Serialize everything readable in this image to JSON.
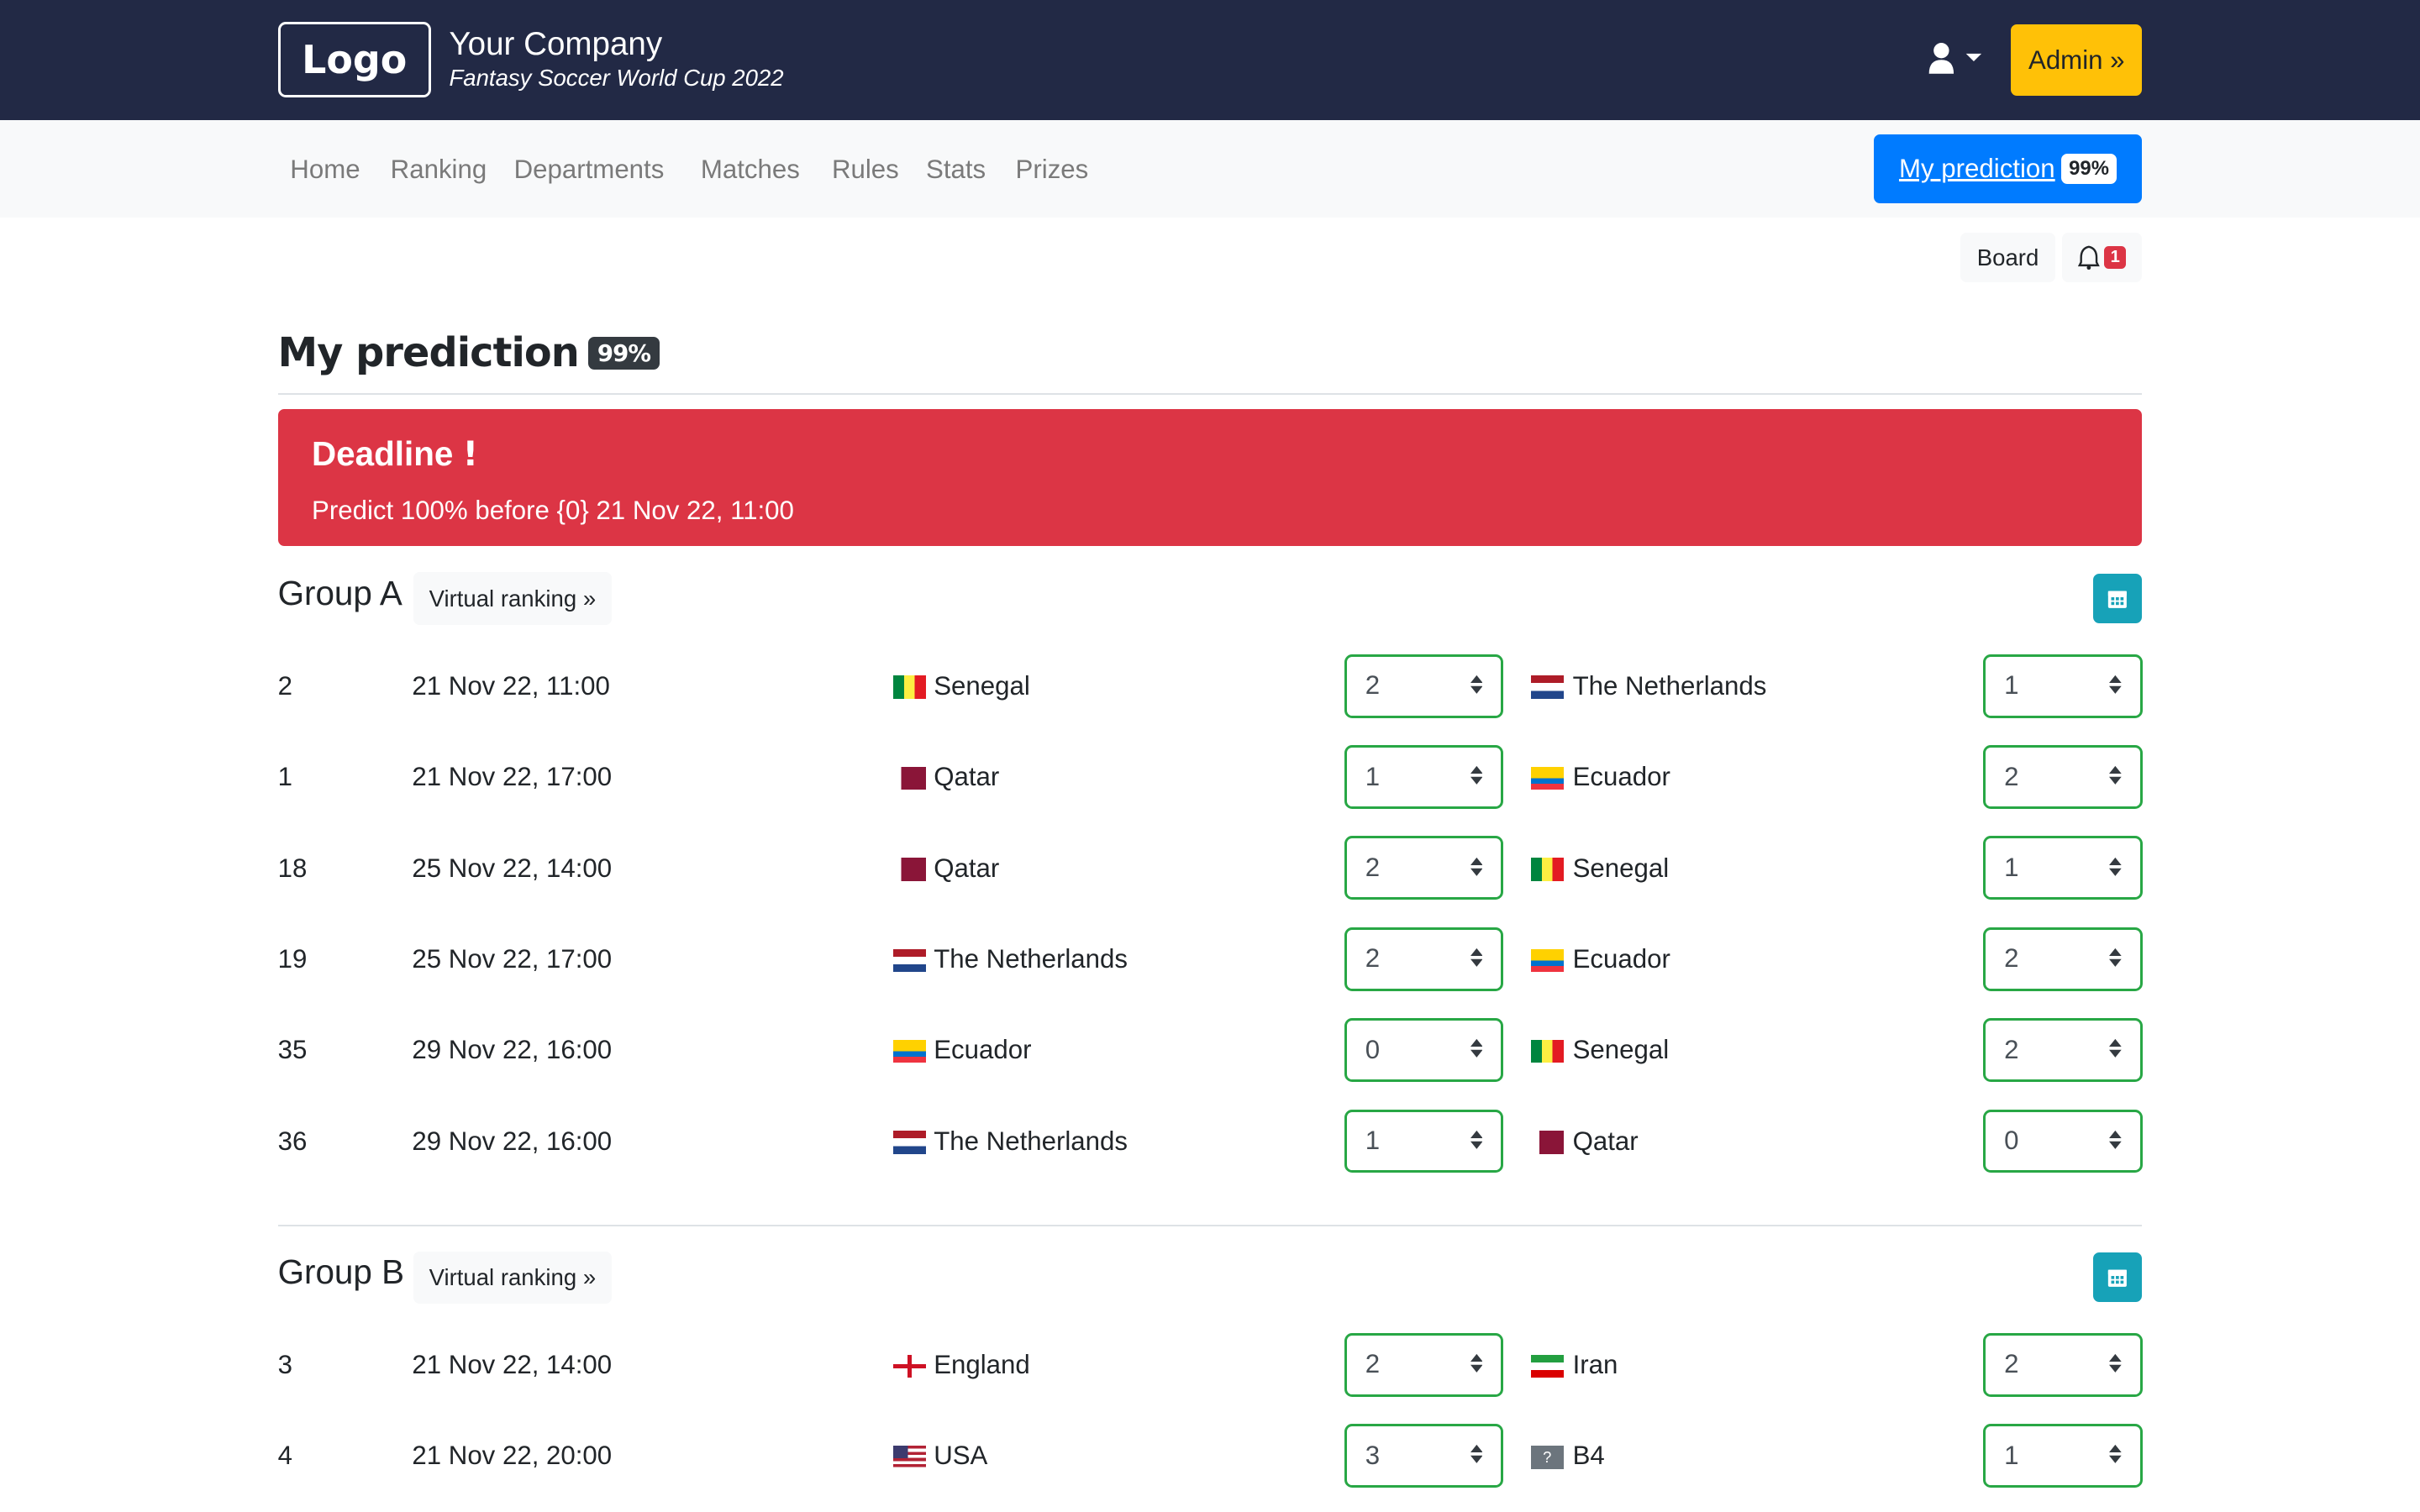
{
  "header": {
    "logo": "Logo",
    "company": "Your Company",
    "subtitle": "Fantasy Soccer World Cup 2022",
    "admin": "Admin »",
    "user_icon": "user-icon"
  },
  "nav": {
    "items": [
      "Home",
      "Ranking",
      "Departments",
      "Matches",
      "Rules",
      "Stats",
      "Prizes"
    ],
    "my_prediction": "My prediction",
    "my_prediction_badge": "99%"
  },
  "toolbar": {
    "board": "Board",
    "notifications": "1"
  },
  "page": {
    "title": "My prediction",
    "badge": "99%"
  },
  "alert": {
    "heading": "Deadline",
    "icon": "!",
    "text": "Predict 100% before {0} 21 Nov 22, 11:00"
  },
  "colors": {
    "header": "#222945",
    "admin": "#ffc107",
    "primary": "#007bff",
    "danger": "#dc3545",
    "success": "#28a745",
    "info": "#17a2b8"
  },
  "groups": [
    {
      "name": "Group A",
      "virtual_ranking": "Virtual ranking »",
      "matches": [
        {
          "no": "2",
          "date": "21 Nov 22, 11:00",
          "home": "Senegal",
          "home_flag": "sen",
          "home_score": "2",
          "away": "The Netherlands",
          "away_flag": "ned",
          "away_score": "1"
        },
        {
          "no": "1",
          "date": "21 Nov 22, 17:00",
          "home": "Qatar",
          "home_flag": "qat",
          "home_score": "1",
          "away": "Ecuador",
          "away_flag": "ecu",
          "away_score": "2"
        },
        {
          "no": "18",
          "date": "25 Nov 22, 14:00",
          "home": "Qatar",
          "home_flag": "qat",
          "home_score": "2",
          "away": "Senegal",
          "away_flag": "sen",
          "away_score": "1"
        },
        {
          "no": "19",
          "date": "25 Nov 22, 17:00",
          "home": "The Netherlands",
          "home_flag": "ned",
          "home_score": "2",
          "away": "Ecuador",
          "away_flag": "ecu",
          "away_score": "2"
        },
        {
          "no": "35",
          "date": "29 Nov 22, 16:00",
          "home": "Ecuador",
          "home_flag": "ecu",
          "home_score": "0",
          "away": "Senegal",
          "away_flag": "sen",
          "away_score": "2"
        },
        {
          "no": "36",
          "date": "29 Nov 22, 16:00",
          "home": "The Netherlands",
          "home_flag": "ned",
          "home_score": "1",
          "away": "Qatar",
          "away_flag": "qat",
          "away_score": "0"
        }
      ]
    },
    {
      "name": "Group B",
      "virtual_ranking": "Virtual ranking »",
      "matches": [
        {
          "no": "3",
          "date": "21 Nov 22, 14:00",
          "home": "England",
          "home_flag": "eng",
          "home_score": "2",
          "away": "Iran",
          "away_flag": "irn",
          "away_score": "2"
        },
        {
          "no": "4",
          "date": "21 Nov 22, 20:00",
          "home": "USA",
          "home_flag": "usa",
          "home_score": "3",
          "away": "B4",
          "away_flag": "unknown",
          "away_score": "1"
        }
      ]
    }
  ]
}
